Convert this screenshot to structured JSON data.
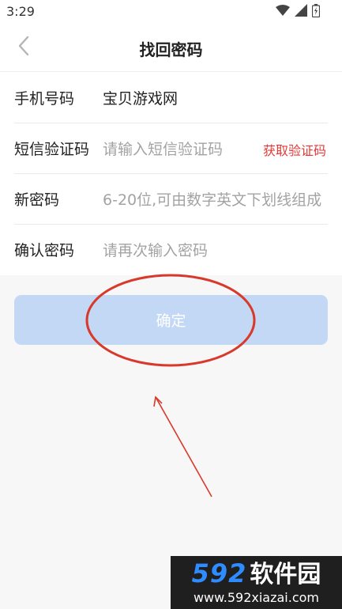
{
  "status": {
    "time": "3:29"
  },
  "header": {
    "title": "找回密码"
  },
  "form": {
    "phone": {
      "label": "手机号码",
      "value": "宝贝游戏网"
    },
    "sms": {
      "label": "短信验证码",
      "placeholder": "请输入短信验证码",
      "action": "获取验证码"
    },
    "new_password": {
      "label": "新密码",
      "placeholder": "6-20位,可由数字英文下划线组成"
    },
    "confirm_password": {
      "label": "确认密码",
      "placeholder": "请再次输入密码"
    }
  },
  "confirm_button": {
    "label": "确定"
  },
  "watermark": {
    "number": "592",
    "name": "软件园",
    "url": "www.592xiazai.com"
  },
  "colors": {
    "button_bg": "#c3d8f5",
    "link_red": "#e33a36",
    "annotation_red": "#d8392b"
  },
  "icons": {
    "back": "chevron-left-icon",
    "wifi": "wifi-icon",
    "signal": "signal-icon",
    "battery": "battery-icon"
  }
}
